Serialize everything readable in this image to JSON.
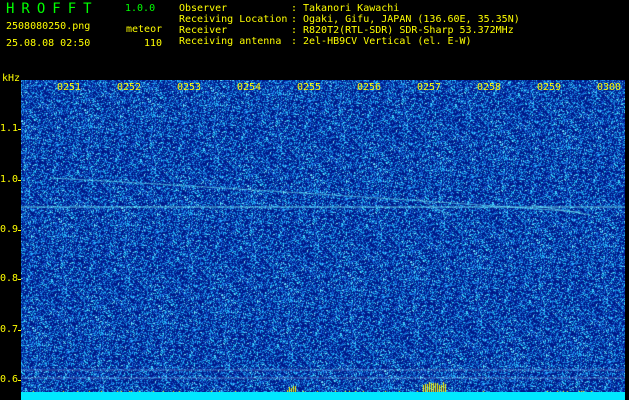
{
  "header": {
    "app_title": "HROFFT",
    "app_version": "1.0.0",
    "file_name": "2508080250.png",
    "mode": "meteor",
    "datetime": "25.08.08 02:50",
    "count": "110"
  },
  "info": {
    "observer_label": "Observer",
    "observer_value": "Takanori Kawachi",
    "location_label": "Receiving Location",
    "location_value": "Ogaki, Gifu, JAPAN (136.60E, 35.35N)",
    "receiver_label": "Receiver",
    "receiver_value": "R820T2(RTL-SDR) SDR-Sharp 53.372MHz",
    "antenna_label": "Receiving antenna",
    "antenna_value": "2el-HB9CV Vertical (el. E-W)",
    "separator": ":"
  },
  "axis": {
    "unit": "kHz",
    "freq_ticks": [
      "1.1",
      "1.0",
      "0.9",
      "0.8",
      "0.7",
      "0.6"
    ],
    "time_labels": [
      "0251",
      "0252",
      "0253",
      "0254",
      "0255",
      "0256",
      "0257",
      "0258",
      "0259",
      "0300"
    ]
  },
  "colors": {
    "background": "#001a8a",
    "noise": "#3fb0ff",
    "signal": "#7fffff",
    "text": "#ffff00",
    "title": "#00ff00"
  }
}
